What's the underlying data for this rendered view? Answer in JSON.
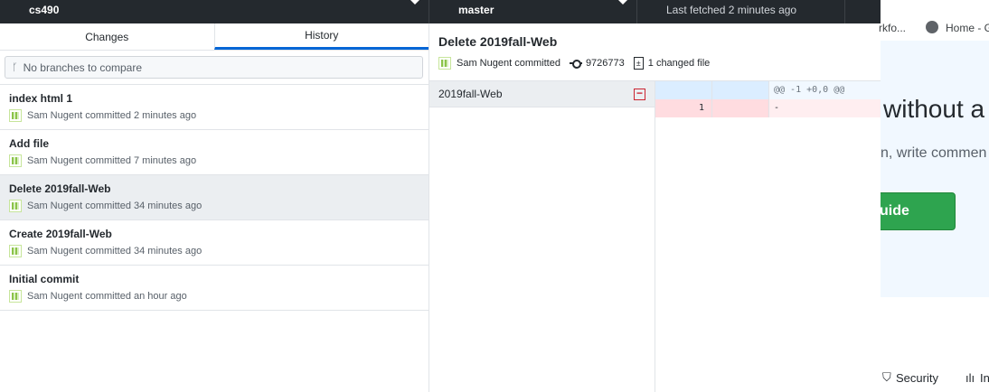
{
  "toolbar": {
    "repo": "cs490",
    "branch": "master",
    "fetch_status": "Last fetched 2 minutes ago"
  },
  "tabs": [
    {
      "label": "Changes"
    },
    {
      "label": "History"
    }
  ],
  "branch_compare": {
    "placeholder": "No branches to compare"
  },
  "commits": [
    {
      "title": "index html 1",
      "meta": "Sam Nugent committed 2 minutes ago"
    },
    {
      "title": "Add file",
      "meta": "Sam Nugent committed 7 minutes ago"
    },
    {
      "title": "Delete 2019fall-Web",
      "meta": "Sam Nugent committed 34 minutes ago"
    },
    {
      "title": "Create 2019fall-Web",
      "meta": "Sam Nugent committed 34 minutes ago"
    },
    {
      "title": "Initial commit",
      "meta": "Sam Nugent committed an hour ago"
    }
  ],
  "selected_commit": {
    "title": "Delete 2019fall-Web",
    "author": "Sam Nugent committed",
    "sha": "9726773",
    "changed_files": "1 changed file"
  },
  "files": [
    {
      "name": "2019fall-Web",
      "status": "deleted"
    }
  ],
  "diff": {
    "hunk": "@@ -1 +0,0 @@",
    "line_number": "1",
    "line_text": "-"
  },
  "browser": {
    "bookmark1": "rkfo...",
    "bookmark2": "Home - G",
    "hero_title": "without a",
    "hero_sub": "n, write commen",
    "hero_button": "uide",
    "footer_security": "Security",
    "footer_insights": "In"
  },
  "colors": {
    "accent": "#0366d6",
    "toolbar": "#24292e",
    "delete": "#cb2431",
    "button": "#2ea44f"
  }
}
